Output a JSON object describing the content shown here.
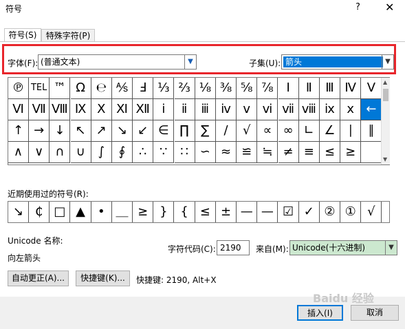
{
  "window": {
    "title": "符号",
    "help": "?",
    "close": "✕"
  },
  "tabs": [
    {
      "label": "符号(S)"
    },
    {
      "label": "特殊字符(P)"
    }
  ],
  "font": {
    "label": "字体(F):",
    "value": "(普通文本)"
  },
  "subset": {
    "label": "子集(U):",
    "value": "箭头"
  },
  "grid_rows": [
    [
      "℗",
      "TEL",
      "™",
      "Ω",
      "℮",
      "⅍",
      "Ⅎ",
      "⅓",
      "⅔",
      "⅛",
      "⅜",
      "⅝",
      "⅞",
      "Ⅰ",
      "Ⅱ",
      "Ⅲ",
      "Ⅳ",
      "Ⅴ"
    ],
    [
      "Ⅵ",
      "Ⅶ",
      "Ⅷ",
      "Ⅸ",
      "Ⅹ",
      "Ⅺ",
      "Ⅻ",
      "ⅰ",
      "ⅱ",
      "ⅲ",
      "ⅳ",
      "ⅴ",
      "ⅵ",
      "ⅶ",
      "ⅷ",
      "ⅸ",
      "ⅹ",
      "←"
    ],
    [
      "↑",
      "→",
      "↓",
      "↖",
      "↗",
      "↘",
      "↙",
      "∈",
      "∏",
      "∑",
      "∕",
      "√",
      "∝",
      "∞",
      "∟",
      "∠",
      "∣",
      "∥"
    ],
    [
      "∧",
      "∨",
      "∩",
      "∪",
      "∫",
      "∮",
      "∴",
      "∵",
      "∷",
      "∽",
      "≈",
      "≌",
      "≒",
      "≠",
      "≡",
      "≤",
      "≥",
      ""
    ]
  ],
  "recent": {
    "label": "近期使用过的符号(R):",
    "symbols": [
      "↘",
      "₵",
      "□",
      "▲",
      "•",
      "＿",
      "≥",
      "}",
      "{",
      "≤",
      "±",
      "—",
      "—",
      "☑",
      "✓",
      "②",
      "①",
      "√"
    ]
  },
  "unicode_name": {
    "label": "Unicode 名称:",
    "value": "向左箭头"
  },
  "char_code": {
    "label": "字符代码(C):",
    "value": "2190"
  },
  "from": {
    "label": "来自(M):",
    "value": "Unicode(十六进制)"
  },
  "buttons": {
    "autocorrect": "自动更正(A)...",
    "shortcut": "快捷键(K)...",
    "insert": "插入(I)",
    "cancel": "取消"
  },
  "shortcut_text": "快捷键: 2190, Alt+X",
  "watermark": "Baidu 经验",
  "colors": {
    "selection": "#0078d7",
    "highlight_box": "#e8262c",
    "from_bg": "#cce8cf"
  }
}
